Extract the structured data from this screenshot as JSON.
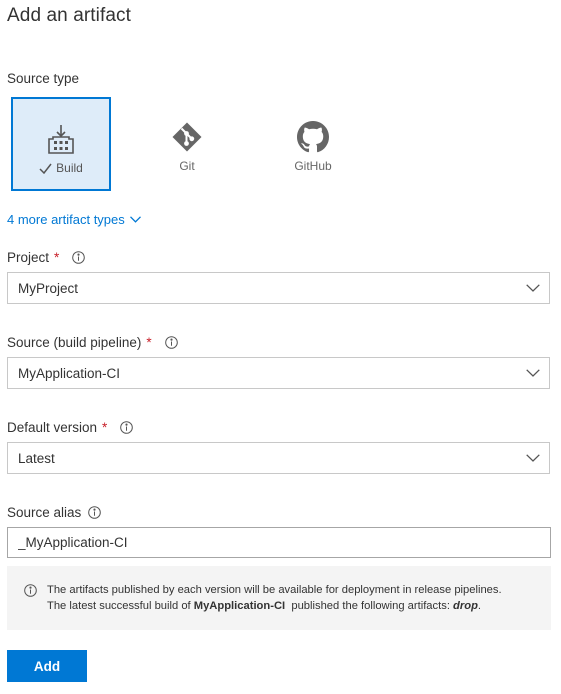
{
  "panel": {
    "title": "Add an artifact"
  },
  "source_type": {
    "label": "Source type",
    "tiles": [
      {
        "label": "Build",
        "icon": "build-icon",
        "selected": true
      },
      {
        "label": "Git",
        "icon": "git-icon",
        "selected": false
      },
      {
        "label": "GitHub",
        "icon": "github-icon",
        "selected": false
      }
    ],
    "more_link": "4 more artifact types"
  },
  "project": {
    "label": "Project",
    "required_marker": "*",
    "value": "MyProject"
  },
  "source_pipeline": {
    "label": "Source (build pipeline)",
    "required_marker": "*",
    "value": "MyApplication-CI"
  },
  "default_version": {
    "label": "Default version",
    "required_marker": "*",
    "value": "Latest"
  },
  "source_alias": {
    "label": "Source alias",
    "value": "_MyApplication-CI"
  },
  "info_message": {
    "line1": "The artifacts published by each version will be available for deployment in release pipelines.",
    "line2_prefix": "The latest successful build of ",
    "line2_pipeline": "MyApplication-CI",
    "line2_middle": "  published the following artifacts: ",
    "line2_artifact": "drop",
    "line2_suffix": "."
  },
  "actions": {
    "add_label": "Add"
  },
  "colors": {
    "accent": "#0078d4",
    "selected_tile_bg": "#deecf9",
    "required": "#c8202a",
    "info_box_bg": "#f4f4f4",
    "icon_gray": "#666666"
  }
}
